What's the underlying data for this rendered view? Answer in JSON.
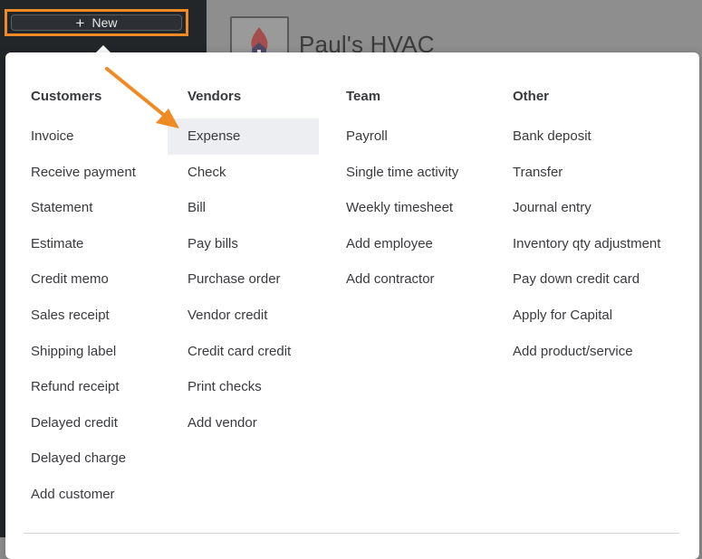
{
  "sidebar": {
    "new_button_label": "New",
    "new_button_icon": "plus-icon"
  },
  "header": {
    "company_name": "Paul's HVAC",
    "logo_icon": "house-flame-logo-icon"
  },
  "menu": {
    "columns": [
      {
        "heading": "Customers",
        "items": [
          "Invoice",
          "Receive payment",
          "Statement",
          "Estimate",
          "Credit memo",
          "Sales receipt",
          "Shipping label",
          "Refund receipt",
          "Delayed credit",
          "Delayed charge",
          "Add customer"
        ]
      },
      {
        "heading": "Vendors",
        "items": [
          "Expense",
          "Check",
          "Bill",
          "Pay bills",
          "Purchase order",
          "Vendor credit",
          "Credit card credit",
          "Print checks",
          "Add vendor"
        ]
      },
      {
        "heading": "Team",
        "items": [
          "Payroll",
          "Single time activity",
          "Weekly timesheet",
          "Add employee",
          "Add contractor"
        ]
      },
      {
        "heading": "Other",
        "items": [
          "Bank deposit",
          "Transfer",
          "Journal entry",
          "Inventory qty adjustment",
          "Pay down credit card",
          "Apply for Capital",
          "Add product/service"
        ]
      }
    ],
    "highlighted_item": "Expense"
  },
  "colors": {
    "accent_annotation": "#f08a24",
    "sidebar_bg": "#232629",
    "highlight_bg": "#eceef1"
  }
}
